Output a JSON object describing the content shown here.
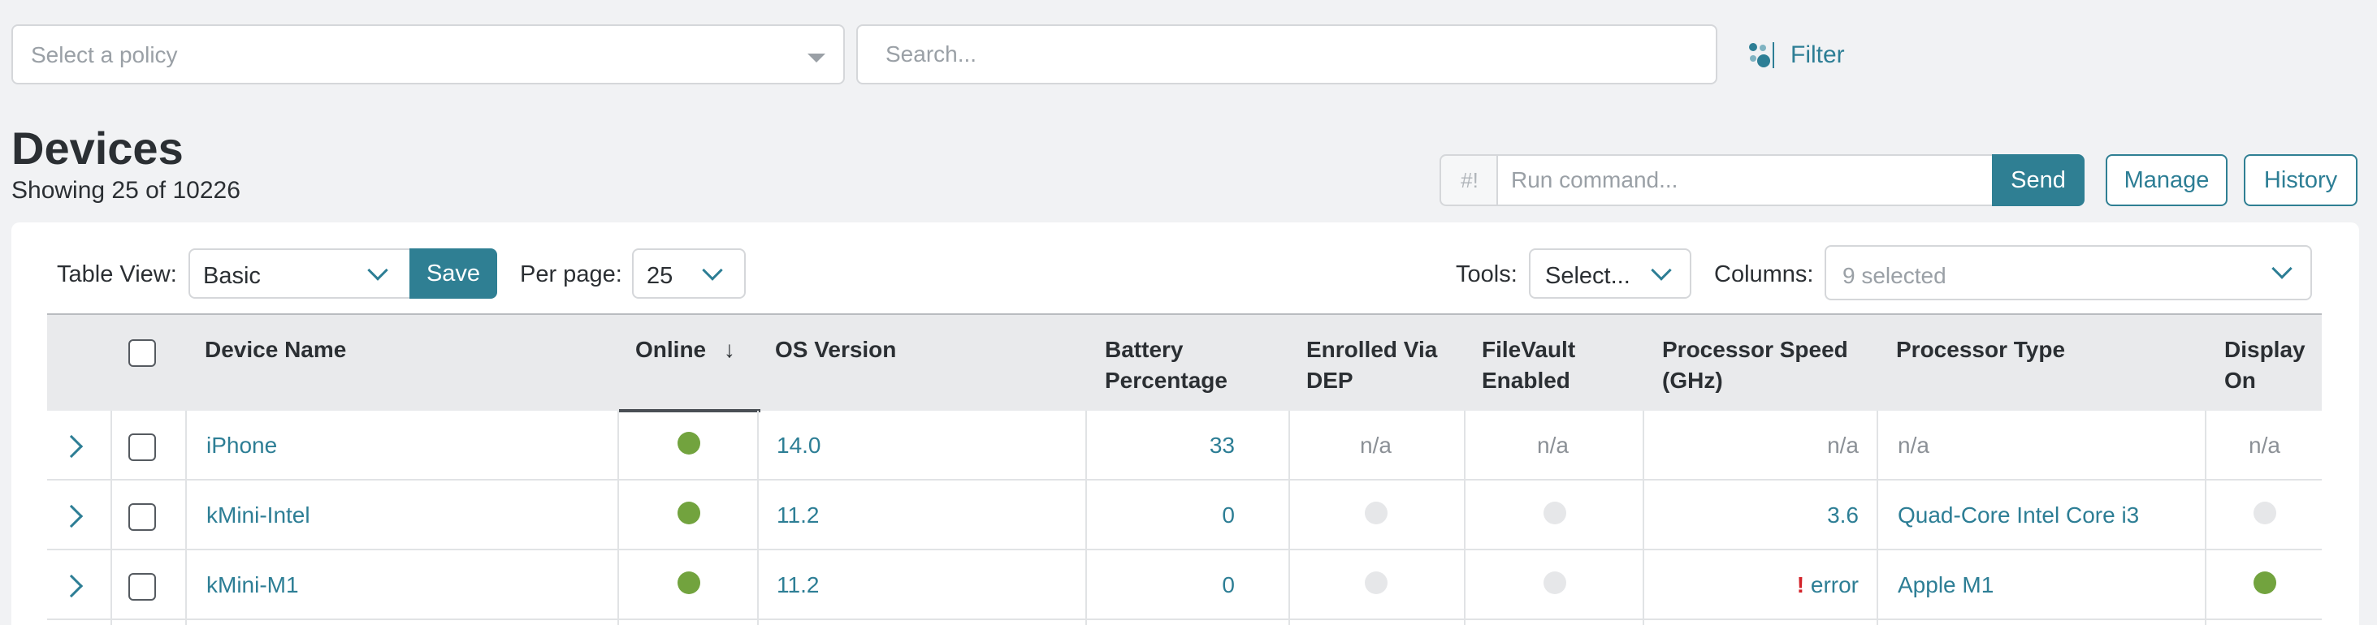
{
  "toolbar": {
    "policy_placeholder": "Select a policy",
    "search_placeholder": "Search...",
    "filter_label": "Filter"
  },
  "header": {
    "title": "Devices",
    "showing": "Showing 25 of 10226"
  },
  "command": {
    "prefix": "#!",
    "placeholder": "Run command...",
    "send_label": "Send",
    "manage_label": "Manage",
    "history_label": "History"
  },
  "controls": {
    "table_view_label": "Table View:",
    "table_view_value": "Basic",
    "save_label": "Save",
    "per_page_label": "Per page:",
    "per_page_value": "25",
    "tools_label": "Tools:",
    "tools_value": "Select...",
    "columns_label": "Columns:",
    "columns_value": "9 selected"
  },
  "table": {
    "columns": {
      "device_name": "Device Name",
      "online": "Online",
      "online_sort": "↓",
      "os_version": "OS Version",
      "battery_1": "Battery",
      "battery_2": "Percentage",
      "dep_1": "Enrolled Via",
      "dep_2": "DEP",
      "filevault_1": "FileVault",
      "filevault_2": "Enabled",
      "speed_1": "Processor Speed",
      "speed_2": "(GHz)",
      "ptype": "Processor Type",
      "display_1": "Display",
      "display_2": "On"
    },
    "rows": [
      {
        "name": "iPhone",
        "online": "online",
        "os": "14.0",
        "battery": "33",
        "dep": "n/a",
        "filevault": "n/a",
        "speed": "n/a",
        "ptype": "n/a",
        "display": "n/a"
      },
      {
        "name": "kMini-Intel",
        "online": "online",
        "os": "11.2",
        "battery": "0",
        "dep": "false",
        "filevault": "false",
        "speed": "3.6",
        "ptype": "Quad-Core Intel Core i3",
        "display": "false"
      },
      {
        "name": "kMini-M1",
        "online": "online",
        "os": "11.2",
        "battery": "0",
        "dep": "false",
        "filevault": "false",
        "speed": "error",
        "speed_mark": "!",
        "ptype": "Apple M1",
        "display": "true"
      }
    ]
  },
  "colors": {
    "accent": "#2f7f93",
    "link": "#2d7e95",
    "online": "#72a33e",
    "false_dot": "#e6e7e9",
    "error": "#d3232a"
  },
  "icons": {
    "filter": "filter-icon",
    "expand": "chevron-right-icon",
    "dropdown": "chevron-down-icon"
  }
}
